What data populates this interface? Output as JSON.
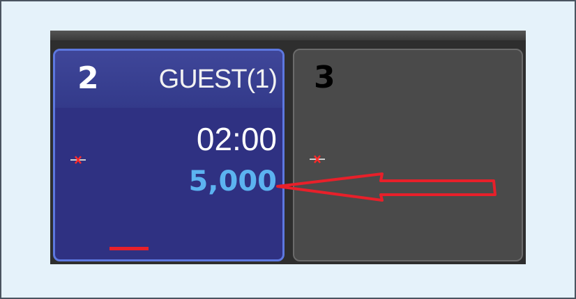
{
  "tables": [
    {
      "number": "2",
      "guest": "GUEST(1)",
      "time": "02:00",
      "amount": "5,000",
      "state": "occupied",
      "colors": {
        "background": "#2f3182",
        "border": "#5d78e0",
        "amount": "#5cb3f0",
        "status_bar": "#e8202a"
      }
    },
    {
      "number": "3",
      "state": "empty",
      "colors": {
        "background": "#4a4a4a",
        "border": "#6b6b6b"
      }
    }
  ],
  "annotation": {
    "type": "arrow",
    "points_to": "amount",
    "color": "#e8202a"
  }
}
